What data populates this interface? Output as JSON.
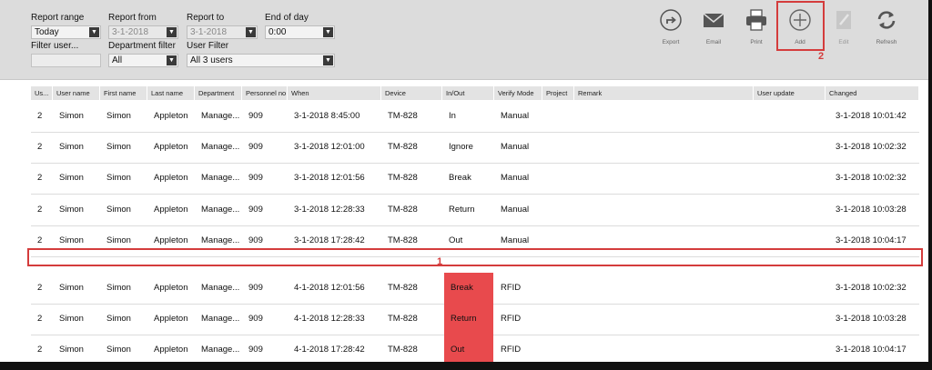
{
  "filters": {
    "report_range": {
      "label": "Report range",
      "value": "Today"
    },
    "report_from": {
      "label": "Report from",
      "value": "3-1-2018"
    },
    "report_to": {
      "label": "Report to",
      "value": "3-1-2018"
    },
    "end_of_day": {
      "label": "End of day",
      "value": "0:00"
    },
    "filter_user": {
      "label": "Filter user...",
      "value": ""
    },
    "department_filter": {
      "label": "Department filter",
      "value": "All"
    },
    "user_filter": {
      "label": "User Filter",
      "value": "All 3 users"
    }
  },
  "toolbar": {
    "export": {
      "label": "Export",
      "icon": "export-icon"
    },
    "email": {
      "label": "Email",
      "icon": "envelope-icon"
    },
    "print": {
      "label": "Print",
      "icon": "printer-icon"
    },
    "add": {
      "label": "Add",
      "icon": "plus-circle-icon"
    },
    "edit": {
      "label": "Edit",
      "icon": "pencil-icon"
    },
    "refresh": {
      "label": "Refresh",
      "icon": "refresh-icon"
    }
  },
  "annotations": {
    "row_marker": "1",
    "add_marker": "2",
    "highlight_color": "#d43c3c",
    "cell_highlight_color": "#e84a4d"
  },
  "table": {
    "columns": [
      "Us...",
      "User name",
      "First name",
      "Last name",
      "Department",
      "Personnel no",
      "When",
      "Device",
      "In/Out",
      "Verify Mode",
      "Project",
      "Remark",
      "User update",
      "Changed"
    ],
    "rows": [
      [
        "2",
        "Simon",
        "Simon",
        "Appleton",
        "Manage...",
        "909",
        "3-1-2018 8:45:00",
        "TM-828",
        "In",
        "Manual",
        "",
        "",
        "",
        "3-1-2018 10:01:42"
      ],
      [
        "2",
        "Simon",
        "Simon",
        "Appleton",
        "Manage...",
        "909",
        "3-1-2018 12:01:00",
        "TM-828",
        "Ignore",
        "Manual",
        "",
        "",
        "",
        "3-1-2018 10:02:32"
      ],
      [
        "2",
        "Simon",
        "Simon",
        "Appleton",
        "Manage...",
        "909",
        "3-1-2018 12:01:56",
        "TM-828",
        "Break",
        "Manual",
        "",
        "",
        "",
        "3-1-2018 10:02:32"
      ],
      [
        "2",
        "Simon",
        "Simon",
        "Appleton",
        "Manage...",
        "909",
        "3-1-2018 12:28:33",
        "TM-828",
        "Return",
        "Manual",
        "",
        "",
        "",
        "3-1-2018 10:03:28"
      ],
      [
        "2",
        "Simon",
        "Simon",
        "Appleton",
        "Manage...",
        "909",
        "3-1-2018 17:28:42",
        "TM-828",
        "Out",
        "Manual",
        "",
        "",
        "",
        "3-1-2018 10:04:17"
      ],
      [
        "2",
        "Simon",
        "Simon",
        "Appleton",
        "Manage...",
        "909",
        "4-1-2018 12:01:56",
        "TM-828",
        "Break",
        "RFID",
        "",
        "",
        "",
        "3-1-2018 10:02:32"
      ],
      [
        "2",
        "Simon",
        "Simon",
        "Appleton",
        "Manage...",
        "909",
        "4-1-2018 12:28:33",
        "TM-828",
        "Return",
        "RFID",
        "",
        "",
        "",
        "3-1-2018 10:03:28"
      ],
      [
        "2",
        "Simon",
        "Simon",
        "Appleton",
        "Manage...",
        "909",
        "4-1-2018 17:28:42",
        "TM-828",
        "Out",
        "RFID",
        "",
        "",
        "",
        "3-1-2018 10:04:17"
      ]
    ],
    "highlighted_rows": [
      5,
      6,
      7
    ],
    "highlighted_column": 8
  }
}
